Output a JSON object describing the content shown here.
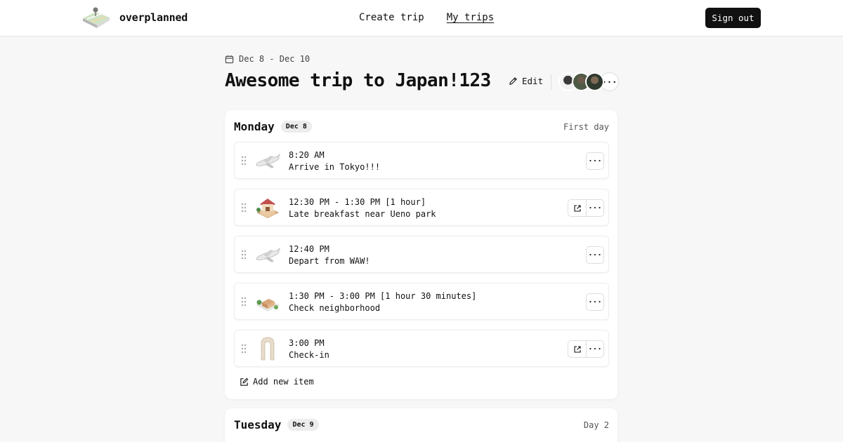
{
  "header": {
    "brand": "overplanned",
    "nav": [
      {
        "label": "Create trip",
        "active": false
      },
      {
        "label": "My trips",
        "active": true
      }
    ],
    "signout_label": "Sign out"
  },
  "trip": {
    "dates": "Dec 8 - Dec 10",
    "title": "Awesome trip to Japan!123",
    "edit_label": "Edit",
    "more_label": "···"
  },
  "days": [
    {
      "name": "Monday",
      "date": "Dec 8",
      "label": "First day",
      "items": [
        {
          "icon": "airplane-icon",
          "time": "8:20 AM",
          "title": "Arrive in Tokyo!!!",
          "has_link": false
        },
        {
          "icon": "restaurant-icon",
          "time": "12:30 PM - 1:30 PM [1 hour]",
          "title": "Late breakfast near Ueno park",
          "has_link": true
        },
        {
          "icon": "airplane-icon",
          "time": "12:40 PM",
          "title": "Depart from WAW!",
          "has_link": false
        },
        {
          "icon": "neighborhood-icon",
          "time": "1:30 PM - 3:00 PM [1 hour 30 minutes]",
          "title": "Check neighborhood",
          "has_link": false
        },
        {
          "icon": "arch-icon",
          "time": "3:00 PM",
          "title": "Check-in",
          "has_link": true
        }
      ],
      "add_label": "Add new item"
    },
    {
      "name": "Tuesday",
      "date": "Dec 9",
      "label": "Day 2"
    }
  ],
  "colors": {
    "background": "#f7f7f7",
    "button_dark": "#111111",
    "badge": "#ececec"
  }
}
